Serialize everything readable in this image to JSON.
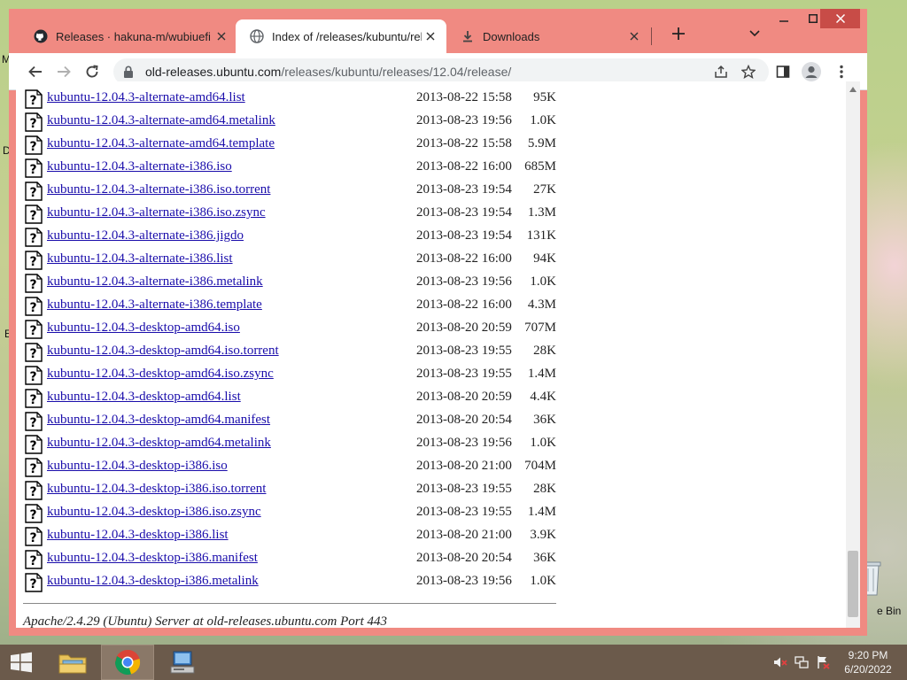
{
  "desktop": {
    "fragments": [
      "M",
      "D",
      "E"
    ],
    "recycle_bin_label": "e Bin"
  },
  "tabs": [
    {
      "title": "Releases · hakuna-m/wubiuefi · G",
      "favicon": "github-icon",
      "active": false
    },
    {
      "title": "Index of /releases/kubuntu/relea",
      "favicon": "globe-icon",
      "active": true
    },
    {
      "title": "Downloads",
      "favicon": "download-icon",
      "active": false
    }
  ],
  "address_bar": {
    "host": "old-releases.ubuntu.com",
    "path": "/releases/kubuntu/releases/12.04/release/"
  },
  "listing": {
    "files": [
      {
        "name": "kubuntu-12.04.3-alternate-amd64.list",
        "modified": "2013-08-22 15:58",
        "size": "95K"
      },
      {
        "name": "kubuntu-12.04.3-alternate-amd64.metalink",
        "modified": "2013-08-23 19:56",
        "size": "1.0K"
      },
      {
        "name": "kubuntu-12.04.3-alternate-amd64.template",
        "modified": "2013-08-22 15:58",
        "size": "5.9M"
      },
      {
        "name": "kubuntu-12.04.3-alternate-i386.iso",
        "modified": "2013-08-22 16:00",
        "size": "685M"
      },
      {
        "name": "kubuntu-12.04.3-alternate-i386.iso.torrent",
        "modified": "2013-08-23 19:54",
        "size": "27K"
      },
      {
        "name": "kubuntu-12.04.3-alternate-i386.iso.zsync",
        "modified": "2013-08-23 19:54",
        "size": "1.3M"
      },
      {
        "name": "kubuntu-12.04.3-alternate-i386.jigdo",
        "modified": "2013-08-23 19:54",
        "size": "131K"
      },
      {
        "name": "kubuntu-12.04.3-alternate-i386.list",
        "modified": "2013-08-22 16:00",
        "size": "94K"
      },
      {
        "name": "kubuntu-12.04.3-alternate-i386.metalink",
        "modified": "2013-08-23 19:56",
        "size": "1.0K"
      },
      {
        "name": "kubuntu-12.04.3-alternate-i386.template",
        "modified": "2013-08-22 16:00",
        "size": "4.3M"
      },
      {
        "name": "kubuntu-12.04.3-desktop-amd64.iso",
        "modified": "2013-08-20 20:59",
        "size": "707M"
      },
      {
        "name": "kubuntu-12.04.3-desktop-amd64.iso.torrent",
        "modified": "2013-08-23 19:55",
        "size": "28K"
      },
      {
        "name": "kubuntu-12.04.3-desktop-amd64.iso.zsync",
        "modified": "2013-08-23 19:55",
        "size": "1.4M"
      },
      {
        "name": "kubuntu-12.04.3-desktop-amd64.list",
        "modified": "2013-08-20 20:59",
        "size": "4.4K"
      },
      {
        "name": "kubuntu-12.04.3-desktop-amd64.manifest",
        "modified": "2013-08-20 20:54",
        "size": "36K"
      },
      {
        "name": "kubuntu-12.04.3-desktop-amd64.metalink",
        "modified": "2013-08-23 19:56",
        "size": "1.0K"
      },
      {
        "name": "kubuntu-12.04.3-desktop-i386.iso",
        "modified": "2013-08-20 21:00",
        "size": "704M"
      },
      {
        "name": "kubuntu-12.04.3-desktop-i386.iso.torrent",
        "modified": "2013-08-23 19:55",
        "size": "28K"
      },
      {
        "name": "kubuntu-12.04.3-desktop-i386.iso.zsync",
        "modified": "2013-08-23 19:55",
        "size": "1.4M"
      },
      {
        "name": "kubuntu-12.04.3-desktop-i386.list",
        "modified": "2013-08-20 21:00",
        "size": "3.9K"
      },
      {
        "name": "kubuntu-12.04.3-desktop-i386.manifest",
        "modified": "2013-08-20 20:54",
        "size": "36K"
      },
      {
        "name": "kubuntu-12.04.3-desktop-i386.metalink",
        "modified": "2013-08-23 19:56",
        "size": "1.0K"
      }
    ],
    "file_icon": "unknown-file-icon",
    "server_signature": "Apache/2.4.29 (Ubuntu) Server at old-releases.ubuntu.com Port 443"
  },
  "taskbar": {
    "items": [
      {
        "name": "file-explorer",
        "icon": "folder-icon"
      },
      {
        "name": "google-chrome",
        "icon": "chrome-icon",
        "active": true
      },
      {
        "name": "computer",
        "icon": "computer-icon"
      }
    ],
    "tray_icons": [
      "speaker-muted-icon",
      "network-icon",
      "action-center-icon"
    ],
    "time": "9:20 PM",
    "date": "6/20/2022"
  },
  "colors": {
    "window_frame": "#f08a82",
    "link": "#1a0dab",
    "taskbar": "#6b5a4b",
    "close_button": "#c84c47"
  }
}
